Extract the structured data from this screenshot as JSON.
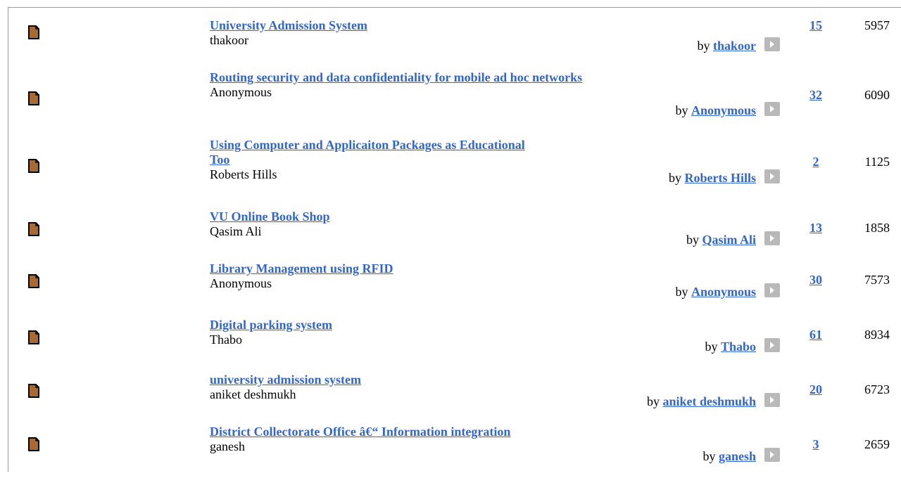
{
  "topics": [
    {
      "title": "University Admission System",
      "author": "thakoor",
      "by_label": "by",
      "poster": "thakoor",
      "replies": "15",
      "views": "5957"
    },
    {
      "title": "Routing security and data confidentiality for mobile ad hoc networks",
      "author": "Anonymous",
      "by_label": "by",
      "poster": "Anonymous",
      "replies": "32",
      "views": "6090"
    },
    {
      "title": "Using Computer and Applicaiton Packages as Educational Too",
      "author": "Roberts Hills",
      "by_label": "by",
      "poster": "Roberts Hills",
      "replies": "2",
      "views": "1125"
    },
    {
      "title": "VU Online Book Shop",
      "author": "Qasim Ali",
      "by_label": "by",
      "poster": "Qasim Ali",
      "replies": "13",
      "views": "1858"
    },
    {
      "title": "Library Management using RFID",
      "author": "Anonymous",
      "by_label": "by",
      "poster": "Anonymous",
      "replies": "30",
      "views": "7573"
    },
    {
      "title": "Digital parking system",
      "author": "Thabo",
      "by_label": "by",
      "poster": "Thabo",
      "replies": "61",
      "views": "8934"
    },
    {
      "title": "university admission system",
      "author": "aniket deshmukh",
      "by_label": "by",
      "poster": "aniket deshmukh",
      "replies": "20",
      "views": "6723"
    },
    {
      "title": "District Collectorate Office â€“ Information integration",
      "author": "ganesh",
      "by_label": "by",
      "poster": "ganesh",
      "replies": "3",
      "views": "2659"
    }
  ],
  "icons": {
    "topic": "document-icon",
    "go": "arrow-right-icon"
  },
  "colors": {
    "link": "#3366cc",
    "icon_fill": "#a86a32",
    "button": "#b9b9b9"
  }
}
